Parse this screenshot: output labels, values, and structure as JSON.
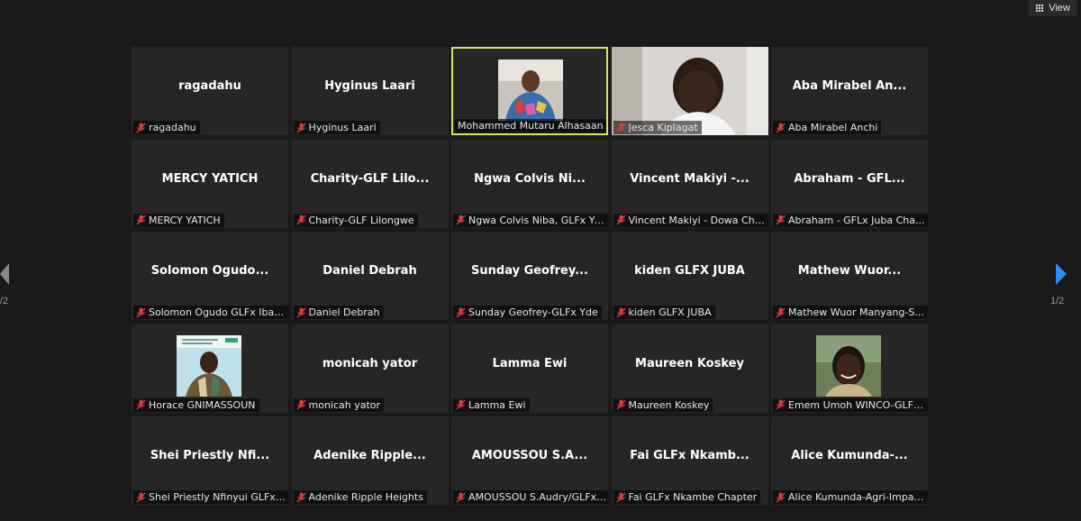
{
  "view_button": {
    "label": "View"
  },
  "pagination": {
    "left_label": "/2",
    "right_label": "1/2"
  },
  "tiles": [
    {
      "center": "ragadahu",
      "label": "ragadahu"
    },
    {
      "center": "Hyginus Laari",
      "label": "Hyginus Laari"
    },
    {
      "center": "",
      "label": "Mohammed Mutaru Alhasaan",
      "video": true,
      "active": true
    },
    {
      "center": "",
      "label": "Jesca Kiplagat",
      "video": true
    },
    {
      "center": "Aba Mirabel An...",
      "label": "Aba Mirabel Anchi"
    },
    {
      "center": "MERCY YATICH",
      "label": "MERCY YATICH"
    },
    {
      "center": "Charity-GLF  Lilo...",
      "label": "Charity-GLF Lilongwe"
    },
    {
      "center": "Ngwa  Colvis  Ni...",
      "label": "Ngwa Colvis Niba, GLFx YA..."
    },
    {
      "center": "Vincent  Makiyi  -...",
      "label": "Vincent Makiyi - Dowa Cha..."
    },
    {
      "center": "Abraham   - GFL...",
      "label": "Abraham  - GFLx Juba Cha..."
    },
    {
      "center": "Solomon  Ogudo...",
      "label": "Solomon Ogudo GLFx Ibad..."
    },
    {
      "center": "Daniel Debrah",
      "label": "Daniel Debrah"
    },
    {
      "center": "Sunday  Geofrey...",
      "label": "Sunday Geofrey-GLFx Yde"
    },
    {
      "center": "kiden GLFX JUBA",
      "label": "kiden GLFX JUBA"
    },
    {
      "center": "Mathew  Wuor...",
      "label": "Mathew Wuor Manyang-S..."
    },
    {
      "center": "",
      "label": "Horace GNIMASSOUN",
      "photo": true
    },
    {
      "center": "monicah yator",
      "label": "monicah yator"
    },
    {
      "center": "Lamma Ewi",
      "label": "Lamma Ewi"
    },
    {
      "center": "Maureen Koskey",
      "label": "Maureen Koskey"
    },
    {
      "center": "",
      "label": "Emem Umoh WINCO-GLFx...",
      "photo": true
    },
    {
      "center": "Shei  Priestly  Nfi...",
      "label": "Shei Priestly Nfinyui GLFx Y..."
    },
    {
      "center": "Adenike  Ripple...",
      "label": "Adenike Ripple Heights"
    },
    {
      "center": "AMOUSSOU  S.A...",
      "label": "AMOUSSOU S.Audry/GLFx ..."
    },
    {
      "center": "Fai GLFx  Nkamb...",
      "label": "Fai GLFx Nkambe Chapter"
    },
    {
      "center": "Alice  Kumunda-...",
      "label": "Alice Kumunda-Agri-Impac..."
    }
  ]
}
